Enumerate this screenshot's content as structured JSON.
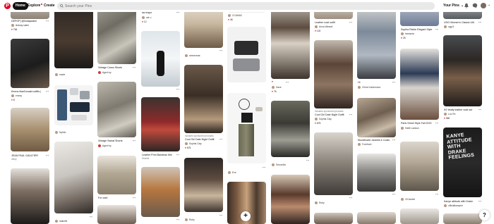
{
  "nav": {
    "logo": "P",
    "home": "Home",
    "explore": "Explore",
    "create": "Create",
    "your_pins": "Your Pins"
  },
  "search": {
    "placeholder": "Search your Pins"
  },
  "colors": {
    "brand": "#e60023",
    "search_bg": "#e9e9e9"
  },
  "icons": [
    "pinterest-logo-icon",
    "search-icon",
    "bell-icon",
    "chat-icon",
    "chevron-down-icon",
    "heart-icon",
    "more-icon",
    "plus-icon",
    "help-icon"
  ],
  "pins": {
    "c1p1": {
      "title": "DEPOP| @lindaysalee",
      "user": "lindsay salee",
      "likes": "764"
    },
    "c1p2": {
      "title": "Emma MacDonald outfits |",
      "user": "emmy",
      "likes": "8"
    },
    "c1p3": {
      "title": "JEAN PAUL GAULTIER",
      "user": "dMxy"
    },
    "c2p1": {
      "user": "marie"
    },
    "c2p2": {
      "user": "Nyhttc"
    },
    "c2p3": {
      "user": "Isabelle"
    },
    "c3p1": {
      "title": "Vintage Camo Shorts",
      "user": "Aged ivy"
    },
    "c3p2": {
      "title": "Vintage Sweat Shorts",
      "user": "Aged ivy"
    },
    "c3p3": {
      "title": "For ootd"
    },
    "c4p1": {
      "title": "fall inspo",
      "user": "cat ∞",
      "likes": "12"
    },
    "c4p2": {
      "title": "Leather Print Bandeau Min",
      "user": "Shichie"
    },
    "c5p1": {
      "user": "amnoxeaa"
    },
    "c5p2": {
      "title": "includes sponsored products",
      "subtitle": "Cool Girl Date Night Outfit",
      "user": "Sophia Clay",
      "likes": "675"
    },
    "c5p3": {
      "user": "Ruby"
    },
    "c6p1": {
      "user": "CC&MAC",
      "likes": "46"
    },
    "c6p2": {
      "user": "Eve"
    },
    "c7p1": {
      "user": "Dave",
      "likes": "76"
    },
    "c7p2": {
      "user": "Secundla"
    },
    "c8p1": {
      "title": "Leather coat outfit",
      "user": "Anna Wessel",
      "likes": "120"
    },
    "c8p2": {
      "title": "includes sponsored products",
      "subtitle": "Cool Girl Date Night Outfit",
      "user": "Sophia Clay",
      "likes": "675"
    },
    "c8p3": {
      "user": "Ruby"
    },
    "c9p1": {
      "title": "Hi",
      "user": "Chloe Kaminnova"
    },
    "c9p2": {
      "title": "Moodboard Jackets & Coats",
      "user": "Forefront"
    },
    "c9p3": {
      "user": "CCaviar"
    },
    "c10p1": {
      "title": "Sophia Richie Elegant Style",
      "user": "hemanta",
      "likes": "25"
    },
    "c10p2": {
      "title": "Paris Street Style Fall 2023",
      "user": "Halle Lawson"
    },
    "c10p3": {
      "user": "ClCanisel"
    },
    "c11p1": {
      "title": "UGG Women's Classic Ultr",
      "user": "ugg 5"
    },
    "c11p2": {
      "title": "94' teddy leather coat out",
      "user": "Lov Rh",
      "likes": "960"
    },
    "c11p3": {
      "title": "Kanye attitude with Drake",
      "user": "officialkanyem",
      "text_art": [
        "KANYE",
        "ATTITUDE",
        "WITH",
        "DRAKE",
        "FEELINGS"
      ]
    }
  }
}
